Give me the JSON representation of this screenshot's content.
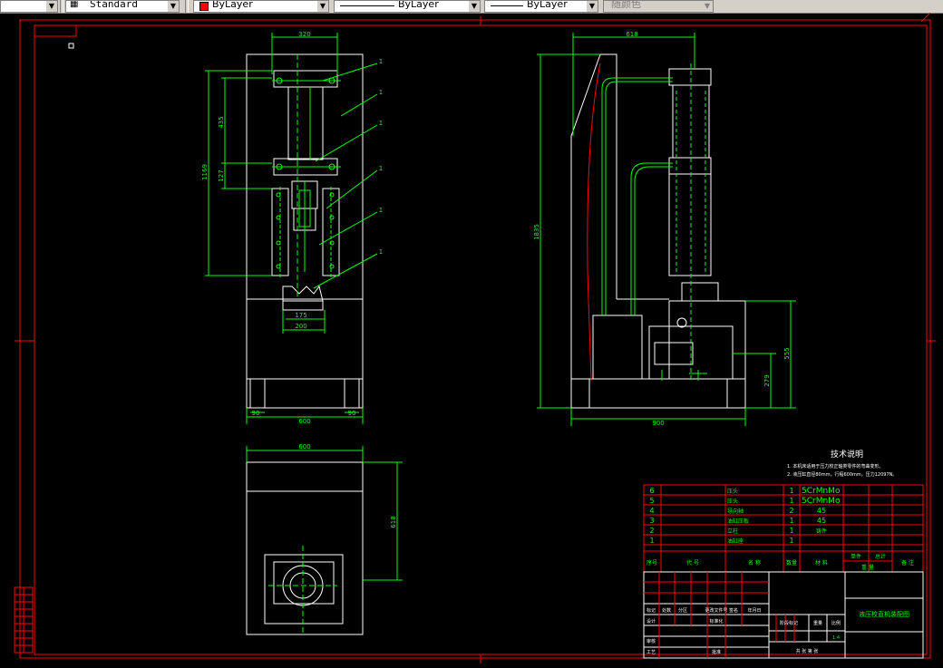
{
  "toolbar": {
    "textstyle": "Standard",
    "layer": "ByLayer",
    "linetype": "ByLayer",
    "lineweight": "ByLayer",
    "plotstyle": "随颜色"
  },
  "front_view": {
    "width_top": "320",
    "width_base": "600",
    "foot_left": "90",
    "foot_right": "90",
    "height_total": "1169",
    "height_upper": "435",
    "height_lower": "127",
    "die_inner": "175",
    "die_outer": "200",
    "leader_labels": [
      "1",
      "1",
      "1",
      "1",
      "1",
      "1"
    ]
  },
  "side_view": {
    "width_top": "618",
    "width_base": "900",
    "height_total": "1835",
    "height_mid": "555",
    "height_low": "279"
  },
  "top_view": {
    "width": "600",
    "depth": "618"
  },
  "tech_notes": {
    "title": "技术说明",
    "lines": [
      "1. 本机床适用于压力校正轴类零件的弯曲变形。",
      "2. 液压缸直径80mm，行程600mm，压力12097N。"
    ]
  },
  "bom": {
    "rows": [
      {
        "no": "6",
        "name": "压头",
        "qty": "1",
        "material": "5CrMnMo",
        "note": ""
      },
      {
        "no": "5",
        "name": "压头",
        "qty": "1",
        "material": "5CrMnMo",
        "note": ""
      },
      {
        "no": "4",
        "name": "导向轴",
        "qty": "2",
        "material": "45",
        "note": ""
      },
      {
        "no": "3",
        "name": "油缸压板",
        "qty": "1",
        "material": "45",
        "note": ""
      },
      {
        "no": "2",
        "name": "立柱",
        "qty": "1",
        "material": "铸件",
        "note": ""
      },
      {
        "no": "1",
        "name": "油缸座",
        "qty": "1",
        "material": "",
        "note": ""
      }
    ],
    "header": [
      "序号",
      "代 号",
      "名 称",
      "数量",
      "材 料",
      "单件",
      "总计",
      "备 注"
    ],
    "header_sub": [
      "重 量"
    ]
  },
  "titleblock": {
    "drawing_title": "液压校直机装配图",
    "labels": [
      "标记",
      "处数",
      "分区",
      "更改文件号",
      "签名",
      "年月日",
      "设计",
      "标准化",
      "阶段标记",
      "重量",
      "比例",
      "审核",
      "工艺",
      "批准",
      "共 张 第 张"
    ],
    "scale": "1:4"
  }
}
